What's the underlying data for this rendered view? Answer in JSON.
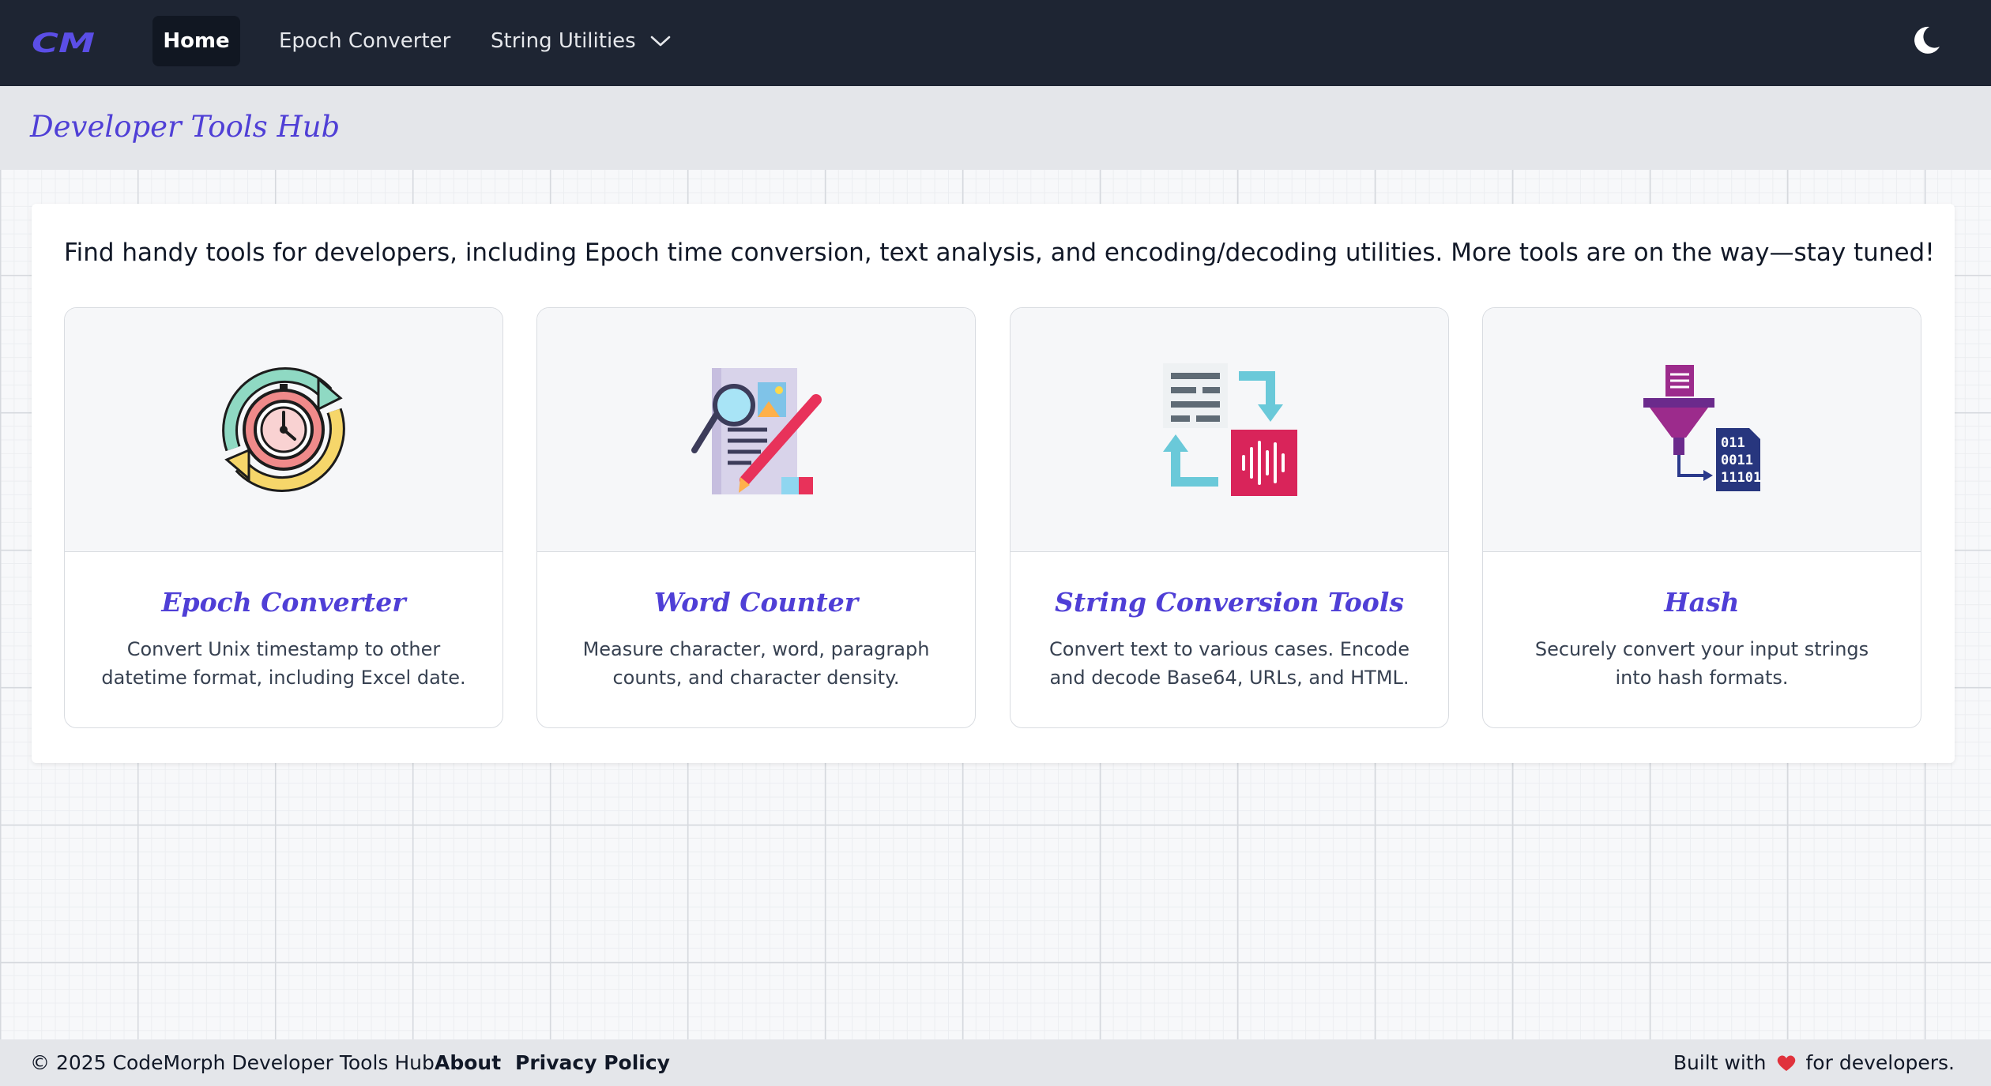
{
  "brand": {
    "logo_text": "CM"
  },
  "nav": {
    "home": "Home",
    "epoch": "Epoch Converter",
    "strings": "String Utilities"
  },
  "header": {
    "title": "Developer Tools Hub"
  },
  "main": {
    "intro": "Find handy tools for developers, including Epoch time conversion, text analysis, and encoding/decoding utilities. More tools are on the way—stay tuned!",
    "cards": [
      {
        "title": "Epoch Converter",
        "desc": "Convert Unix timestamp to other datetime format, including Excel date.",
        "icon": "clock-cycle-icon"
      },
      {
        "title": "Word Counter",
        "desc": "Measure character, word, paragraph counts, and character density.",
        "icon": "document-magnifier-icon"
      },
      {
        "title": "String Conversion Tools",
        "desc": "Convert text to various cases. Encode and decode Base64, URLs, and HTML.",
        "icon": "text-convert-icon"
      },
      {
        "title": "Hash",
        "desc": "Securely convert your input strings into hash formats.",
        "icon": "funnel-binary-icon"
      }
    ]
  },
  "footer": {
    "copyright": "© 2025 CodeMorph Developer Tools Hub.",
    "about": "About",
    "privacy": "Privacy Policy",
    "built_prefix": "Built with",
    "built_suffix": "for developers."
  },
  "colors": {
    "accent": "#4f3fd6",
    "navbar": "#1e2533",
    "heart": "#e0323c"
  }
}
